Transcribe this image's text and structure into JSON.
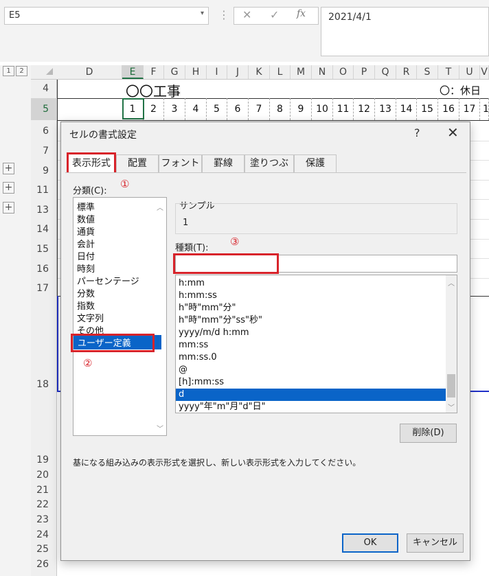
{
  "formula_bar": {
    "name_box": "E5",
    "name_box_dropdown": "▾",
    "cancel_icon": "✕",
    "enter_icon": "✓",
    "fx_label": "fx",
    "formula_value": "2021/4/1"
  },
  "sheet": {
    "outline_levels": [
      "1",
      "2"
    ],
    "outline_expand": [
      "+",
      "+",
      "+"
    ],
    "columns": [
      "D",
      "E",
      "F",
      "G",
      "H",
      "I",
      "J",
      "K",
      "L",
      "M",
      "N",
      "O",
      "P",
      "Q",
      "R",
      "S",
      "T",
      "U",
      "V"
    ],
    "selected_column": "E",
    "rows": [
      "4",
      "5",
      "6",
      "7",
      "9",
      "11",
      "13",
      "14",
      "15",
      "16",
      "17",
      "18",
      "19",
      "20",
      "21",
      "22",
      "23",
      "24",
      "25",
      "26"
    ],
    "selected_row": "5",
    "title": "〇〇工事",
    "holiday_legend": "〇：休日",
    "day_numbers": [
      "1",
      "2",
      "3",
      "4",
      "5",
      "6",
      "7",
      "8",
      "9",
      "10",
      "11",
      "12",
      "13",
      "14",
      "15",
      "16",
      "17",
      "1"
    ]
  },
  "dialog": {
    "title": "セルの書式設定",
    "help": "?",
    "close": "✕",
    "tabs": [
      "表示形式",
      "配置",
      "フォント",
      "罫線",
      "塗りつぶし",
      "保護"
    ],
    "active_tab": "表示形式",
    "category_label": "分類(C):",
    "categories": [
      "標準",
      "数値",
      "通貨",
      "会計",
      "日付",
      "時刻",
      "パーセンテージ",
      "分数",
      "指数",
      "文字列",
      "その他",
      "ユーザー定義"
    ],
    "selected_category": "ユーザー定義",
    "sample_label": "サンプル",
    "sample_value": "1",
    "type_label": "種類(T):",
    "type_value": "",
    "formats": [
      "h:mm",
      "h:mm:ss",
      "h\"時\"mm\"分\"",
      "h\"時\"mm\"分\"ss\"秒\"",
      "yyyy/m/d h:mm",
      "mm:ss",
      "mm:ss.0",
      "@",
      "[h]:mm:ss",
      "d",
      "yyyy\"年\"m\"月\"d\"日\""
    ],
    "selected_format": "d",
    "delete_button": "削除(D)",
    "description": "基になる組み込みの表示形式を選択し、新しい表示形式を入力してください。",
    "ok_button": "OK",
    "cancel_button": "キャンセル",
    "annotations": [
      "①",
      "②",
      "③"
    ]
  },
  "colors": {
    "excel_green": "#217346",
    "highlight_red": "#d8232a",
    "selection_blue": "#0a64c8"
  }
}
